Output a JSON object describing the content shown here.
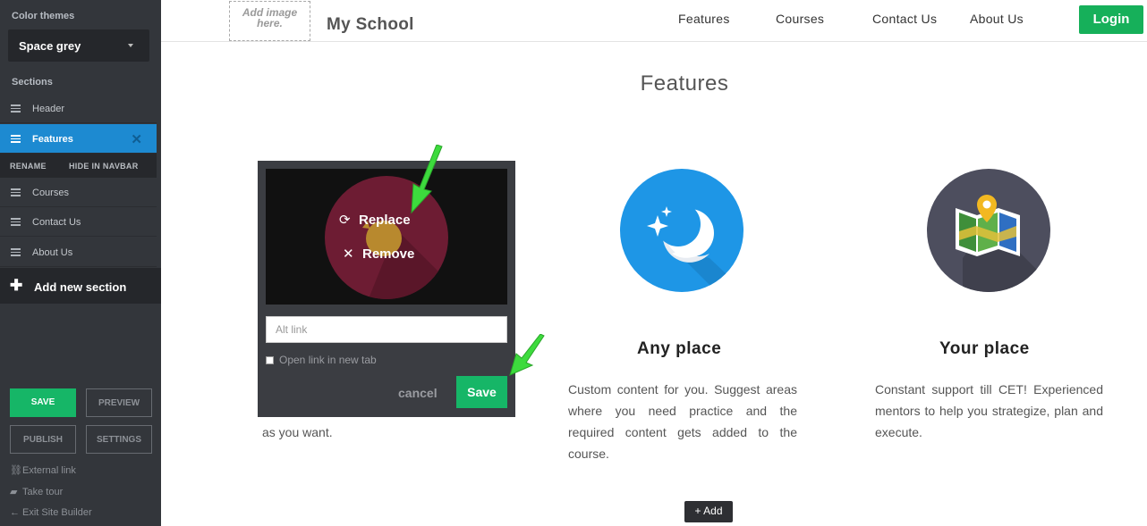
{
  "sidebar": {
    "color_themes_label": "Color themes",
    "theme_value": "Space grey",
    "sections_label": "Sections",
    "items": [
      {
        "label": "Header"
      },
      {
        "label": "Features"
      },
      {
        "label": "Courses"
      },
      {
        "label": "Contact Us"
      },
      {
        "label": "About Us"
      }
    ],
    "sub_actions": {
      "rename": "RENAME",
      "hide": "HIDE IN NAVBAR"
    },
    "add_section": "Add new section",
    "buttons": {
      "save": "SAVE",
      "preview": "PREVIEW",
      "publish": "PUBLISH",
      "settings": "SETTINGS"
    },
    "links": {
      "external": "External link",
      "tour": "Take tour",
      "exit": "Exit Site Builder"
    }
  },
  "nav": {
    "logo_placeholder_line1": "Add image",
    "logo_placeholder_line2": "here.",
    "brand": "My School",
    "links": [
      "Features",
      "Courses",
      "Contact Us",
      "About Us"
    ],
    "login": "Login"
  },
  "main": {
    "title": "Features",
    "partial_text": "as you want.",
    "features": [
      {
        "title": "Any place",
        "body": "Custom content for you. Suggest areas where you need practice and the required content gets added to the course.",
        "color": "#1e96e6",
        "icon": "moon-stars-icon"
      },
      {
        "title": "Your place",
        "body": "Constant support till CET! Experienced mentors to help you strategize, plan and execute.",
        "color": "#4d4e5e",
        "icon": "map-pin-icon"
      }
    ],
    "add_button": "+ Add"
  },
  "popup": {
    "replace": "Replace",
    "remove": "Remove",
    "alt_placeholder": "Alt link",
    "new_tab_label": "Open link in new tab",
    "cancel": "cancel",
    "save": "Save",
    "overlay_color": "#6d1c33"
  },
  "colors": {
    "sidebar_bg": "#33363b",
    "accent_blue": "#1d8ad1",
    "accent_green": "#16b667"
  }
}
